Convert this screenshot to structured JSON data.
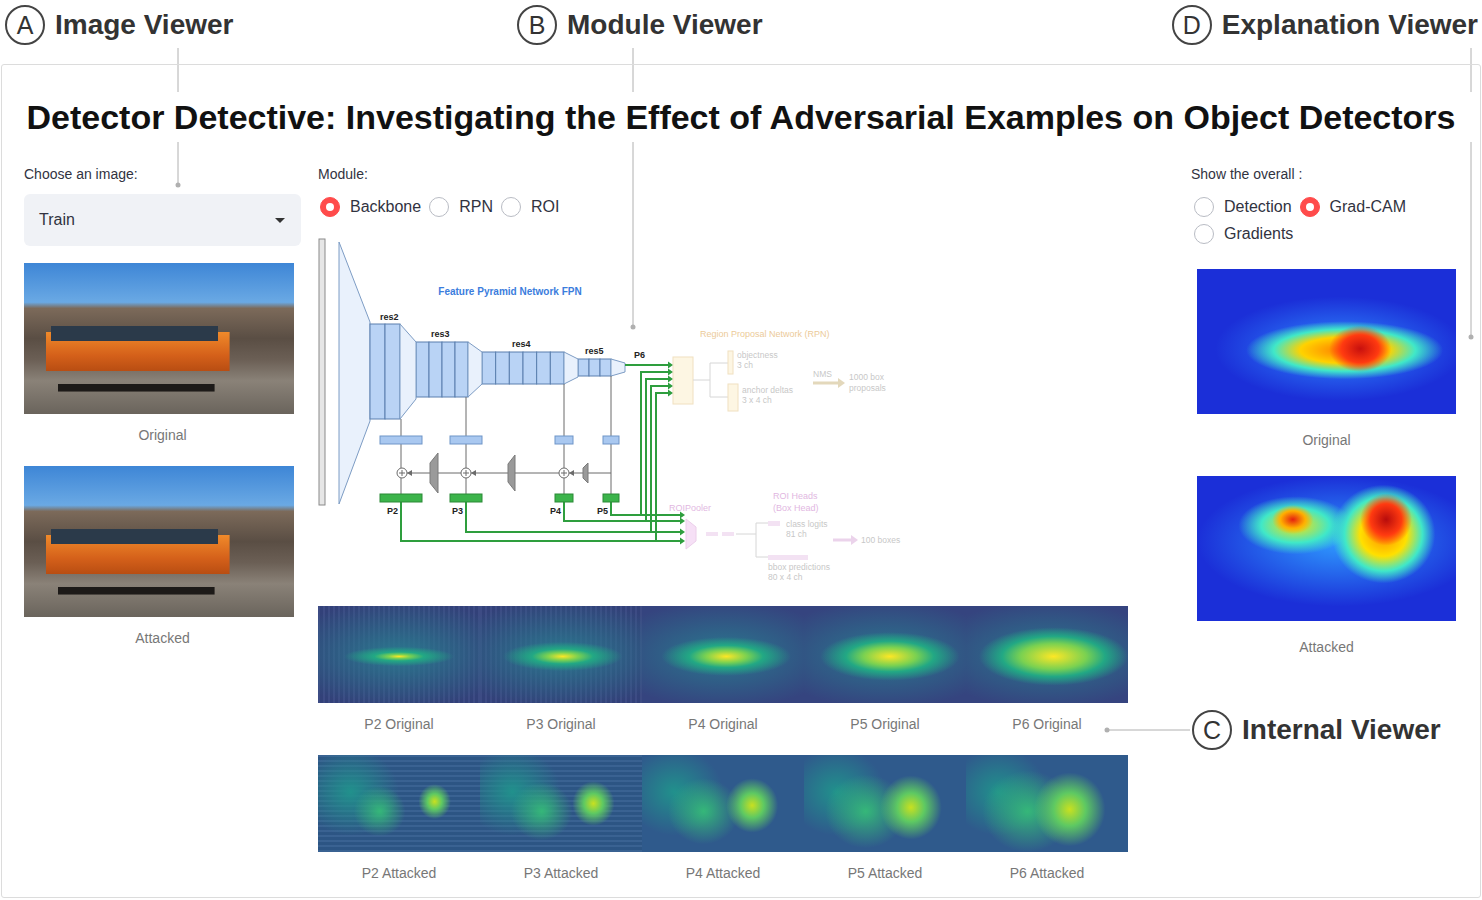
{
  "callouts": [
    {
      "letter": "A",
      "label": "Image Viewer"
    },
    {
      "letter": "B",
      "label": "Module Viewer"
    },
    {
      "letter": "C",
      "label": "Internal Viewer"
    },
    {
      "letter": "D",
      "label": "Explanation Viewer"
    }
  ],
  "title": "Detector Detective: Investigating the Effect of Adversarial Examples on Object Detectors",
  "image_viewer": {
    "label": "Choose an image:",
    "dropdown": {
      "value": "Train"
    },
    "images": [
      {
        "caption": "Original"
      },
      {
        "caption": "Attacked"
      }
    ]
  },
  "module_viewer": {
    "label": "Module:",
    "options": [
      {
        "label": "Backbone",
        "selected": true
      },
      {
        "label": "RPN",
        "selected": false
      },
      {
        "label": "ROI",
        "selected": false
      }
    ],
    "diagram": {
      "backbone": {
        "active": true,
        "title": "Feature Pyramid Network FPN",
        "stages": [
          "res2",
          "res3",
          "res4",
          "res5"
        ],
        "outputs": [
          "P2",
          "P3",
          "P4",
          "P5"
        ],
        "extra_output": "P6"
      },
      "rpn": {
        "active": false,
        "title": "Region Proposal Network (RPN)",
        "heads": [
          {
            "name": "objectness",
            "channels": "3 ch"
          },
          {
            "name": "anchor deltas",
            "channels": "3 x 4 ch"
          }
        ],
        "nms": "NMS",
        "result": [
          "1000 box",
          "proposals"
        ]
      },
      "roi": {
        "active": false,
        "pooler": "ROIPooler",
        "title": [
          "ROI Heads",
          "(Box Head)"
        ],
        "heads": [
          {
            "name": "class logits",
            "channels": "81 ch"
          },
          {
            "name": "bbox predictions",
            "channels": "80 x 4 ch"
          }
        ],
        "result": "100 boxes"
      }
    }
  },
  "internal_viewer": {
    "rows": [
      {
        "kind": "original",
        "maps": [
          {
            "caption": "P2 Original"
          },
          {
            "caption": "P3 Original"
          },
          {
            "caption": "P4 Original"
          },
          {
            "caption": "P5 Original"
          },
          {
            "caption": "P6 Original"
          }
        ]
      },
      {
        "kind": "attacked",
        "maps": [
          {
            "caption": "P2 Attacked"
          },
          {
            "caption": "P3 Attacked"
          },
          {
            "caption": "P4 Attacked"
          },
          {
            "caption": "P5 Attacked"
          },
          {
            "caption": "P6 Attacked"
          }
        ]
      }
    ]
  },
  "explanation_viewer": {
    "label": "Show the overall :",
    "options": [
      {
        "label": "Detection",
        "selected": false
      },
      {
        "label": "Grad-CAM",
        "selected": true
      },
      {
        "label": "Gradients",
        "selected": false
      }
    ],
    "images": [
      {
        "caption": "Original",
        "kind": "original"
      },
      {
        "caption": "Attacked",
        "kind": "attacked"
      }
    ]
  }
}
